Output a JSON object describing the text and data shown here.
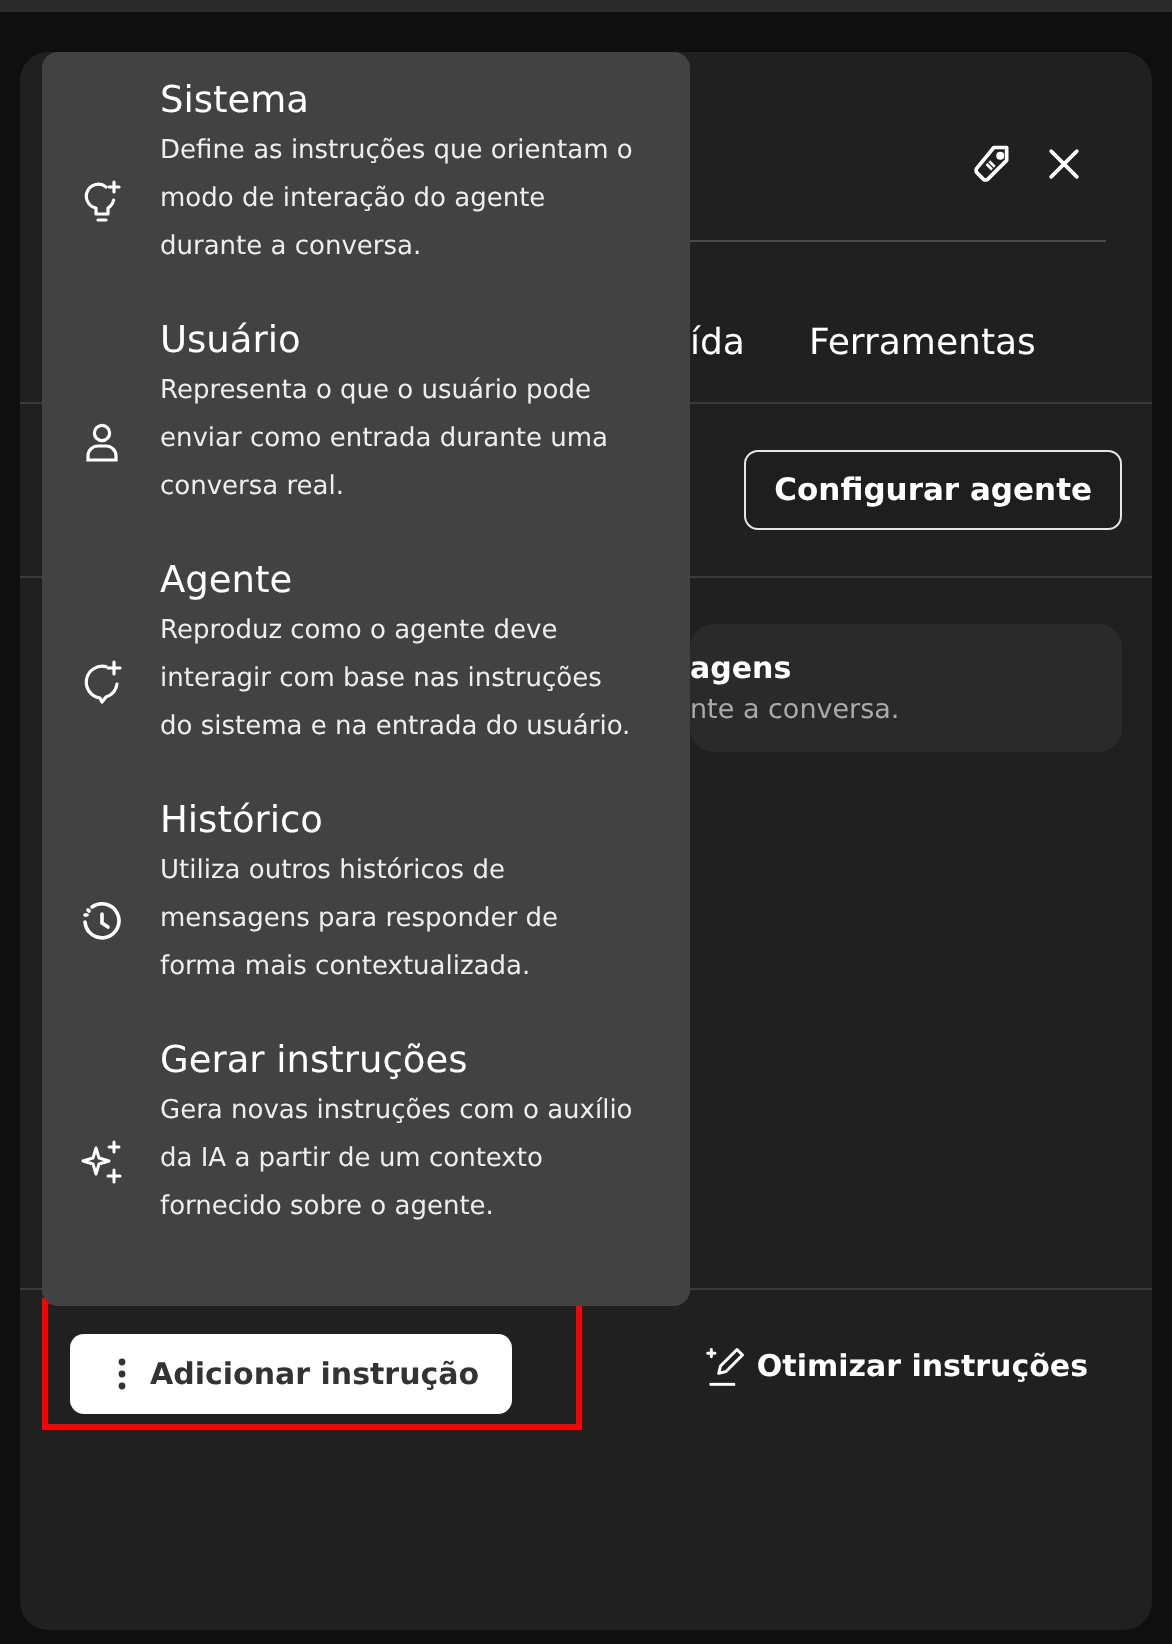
{
  "header": {
    "icons": [
      {
        "kind": "tag"
      },
      {
        "kind": "close"
      }
    ]
  },
  "tabs": [
    {
      "label": "ída",
      "selected": false
    },
    {
      "label": "Ferramentas",
      "selected": false
    }
  ],
  "configure_button": "Configurar agente",
  "card": {
    "title": "agens",
    "text": "nte a conversa."
  },
  "menu": [
    {
      "kind": "system",
      "title": "Sistema",
      "description": "Define as instruções que orientam o modo de interação do agente durante a conversa."
    },
    {
      "kind": "user",
      "title": "Usuário",
      "description": "Representa o que o usuário pode enviar como entrada durante uma conversa real."
    },
    {
      "kind": "agent",
      "title": "Agente",
      "description": "Reproduz como o agente deve interagir com base nas instruções do sistema e na entrada do usuário."
    },
    {
      "kind": "history",
      "title": "Histórico",
      "description": "Utiliza outros históricos de mensagens para responder de forma mais contextualizada."
    },
    {
      "kind": "generate",
      "title": "Gerar instruções",
      "description": "Gera novas instruções com o auxílio da IA a partir de um contexto fornecido sobre o agente."
    }
  ],
  "footer": {
    "add_button": {
      "label": "Adicionar instrução",
      "highlighted": true
    },
    "optimize_button": "Otimizar instruções"
  }
}
